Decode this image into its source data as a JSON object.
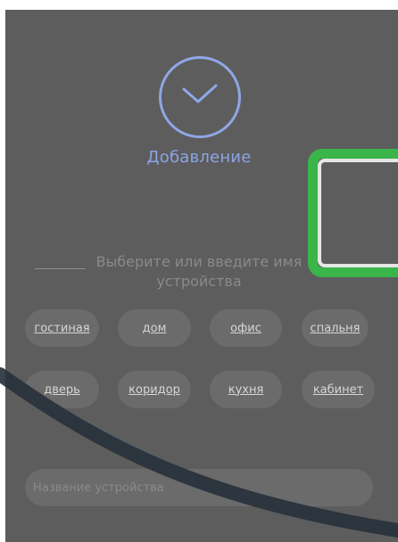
{
  "header": {
    "icon": "checkmark-circle-icon",
    "title": "Добавление"
  },
  "prompt": {
    "text": "Выберите или введите имя устройства"
  },
  "suggestions": [
    "гостиная",
    "дом",
    "офис",
    "спальня",
    "дверь",
    "коридор",
    "кухня",
    "кабинет"
  ],
  "device_name": {
    "value": "",
    "placeholder": "Название устройства"
  },
  "colors": {
    "background": "#5d5d5d",
    "accent": "#8ba4e6",
    "chip": "#6b6b6b",
    "highlight": "#3ab54a"
  }
}
